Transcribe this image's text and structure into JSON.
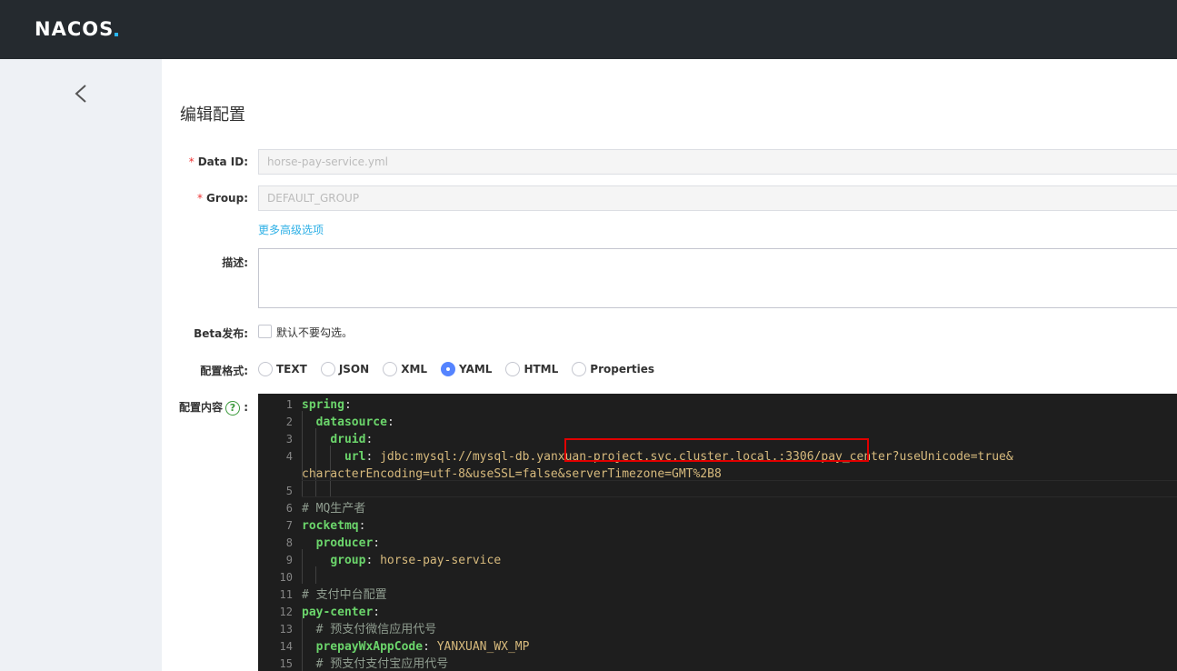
{
  "header": {
    "logo_text": "NACOS",
    "logo_accent": "#2ab6f4"
  },
  "page": {
    "title": "编辑配置"
  },
  "form": {
    "data_id": {
      "label": "Data ID:",
      "value": "horse-pay-service.yml"
    },
    "group": {
      "label": "Group:",
      "value": "DEFAULT_GROUP"
    },
    "advanced_link": "更多高级选项",
    "description": {
      "label": "描述:"
    },
    "beta": {
      "label": "Beta发布:",
      "checkbox_text": "默认不要勾选。"
    },
    "format": {
      "label": "配置格式:",
      "options": [
        "TEXT",
        "JSON",
        "XML",
        "YAML",
        "HTML",
        "Properties"
      ],
      "selected": "YAML"
    },
    "content": {
      "label": "配置内容",
      "help": "?",
      "colon": ":"
    }
  },
  "editor": {
    "lines": [
      {
        "n": "1",
        "key": "spring",
        "rest": ":"
      },
      {
        "n": "2",
        "indent": "  ",
        "key": "datasource",
        "rest": ":"
      },
      {
        "n": "3",
        "indent": "    ",
        "key": "druid",
        "rest": ":"
      },
      {
        "n": "4",
        "indent": "      ",
        "key": "url",
        "rest": ": ",
        "value": "jdbc:mysql://mysql-db.yanxuan-project.svc.cluster.local.:3306/pay_center?useUnicode=true&"
      },
      {
        "n": "",
        "wrap": "characterEncoding=utf-8&useSSL=false&serverTimezone=GMT%2B8"
      },
      {
        "n": "5"
      },
      {
        "n": "6",
        "comment": "# MQ生产者"
      },
      {
        "n": "7",
        "key": "rocketmq",
        "rest": ":"
      },
      {
        "n": "8",
        "indent": "  ",
        "key": "producer",
        "rest": ":"
      },
      {
        "n": "9",
        "indent": "    ",
        "key": "group",
        "rest": ": ",
        "value": "horse-pay-service"
      },
      {
        "n": "10"
      },
      {
        "n": "11",
        "comment": "# 支付中台配置"
      },
      {
        "n": "12",
        "key": "pay-center",
        "rest": ":"
      },
      {
        "n": "13",
        "indent": "  ",
        "comment": "# 预支付微信应用代号"
      },
      {
        "n": "14",
        "indent": "  ",
        "key": "prepayWxAppCode",
        "rest": ": ",
        "value": "YANXUAN_WX_MP"
      },
      {
        "n": "15",
        "indent": "  ",
        "comment": "# 预支付支付宝应用代号"
      }
    ]
  }
}
